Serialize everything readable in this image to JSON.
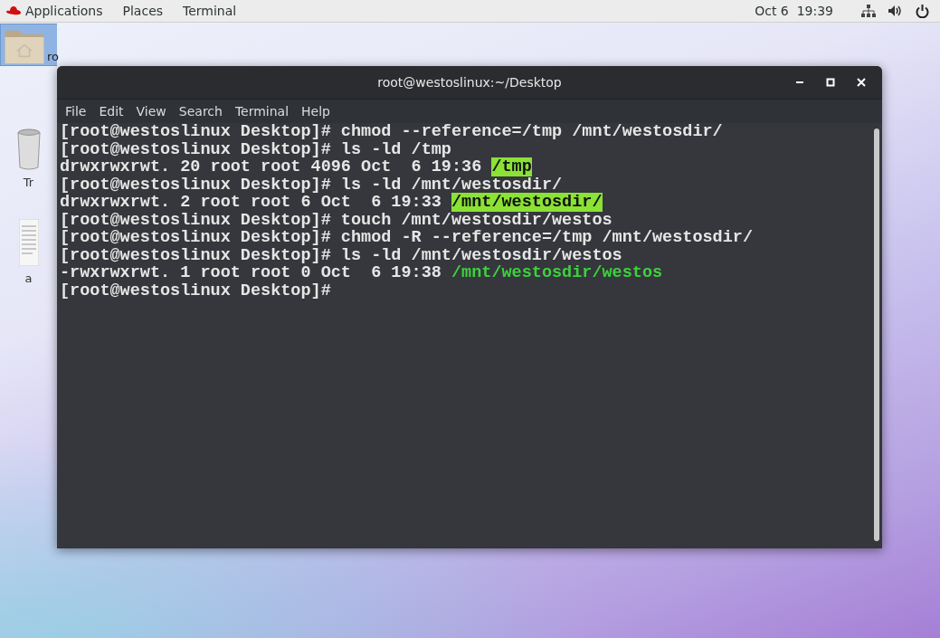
{
  "top_bar": {
    "menus": [
      "Applications",
      "Places",
      "Terminal"
    ],
    "clock": "Oct 6  19:39"
  },
  "desktop_icons": [
    {
      "kind": "folder",
      "label": "ro",
      "selected": true
    },
    {
      "kind": "trash",
      "label": "Tr",
      "selected": false
    },
    {
      "kind": "document",
      "label": "a",
      "selected": false
    }
  ],
  "window": {
    "title": "root@westoslinux:~/Desktop",
    "menus": [
      "File",
      "Edit",
      "View",
      "Search",
      "Terminal",
      "Help"
    ],
    "lines": [
      [
        {
          "kind": "plain",
          "text": "[root@westoslinux Desktop]# chmod --reference=/tmp /mnt/westosdir/"
        }
      ],
      [
        {
          "kind": "plain",
          "text": "[root@westoslinux Desktop]# ls -ld /tmp"
        }
      ],
      [
        {
          "kind": "plain",
          "text": "drwxrwxrwt. 20 root root 4096 Oct  6 19:36 "
        },
        {
          "kind": "directory",
          "text": "/tmp"
        }
      ],
      [
        {
          "kind": "plain",
          "text": "[root@westoslinux Desktop]# ls -ld /mnt/westosdir/"
        }
      ],
      [
        {
          "kind": "plain",
          "text": "drwxrwxrwt. 2 root root 6 Oct  6 19:33 "
        },
        {
          "kind": "directory",
          "text": "/mnt/westosdir/"
        }
      ],
      [
        {
          "kind": "plain",
          "text": "[root@westoslinux Desktop]# touch /mnt/westosdir/westos"
        }
      ],
      [
        {
          "kind": "plain",
          "text": "[root@westoslinux Desktop]# chmod -R --reference=/tmp /mnt/westosdir/"
        }
      ],
      [
        {
          "kind": "plain",
          "text": "[root@westoslinux Desktop]# ls -ld /mnt/westosdir/westos"
        }
      ],
      [
        {
          "kind": "plain",
          "text": "-rwxrwxrwt. 1 root root 0 Oct  6 19:38 "
        },
        {
          "kind": "executable",
          "text": "/mnt/westosdir/westos"
        }
      ],
      [
        {
          "kind": "plain",
          "text": "[root@westoslinux Desktop]#"
        }
      ]
    ]
  }
}
